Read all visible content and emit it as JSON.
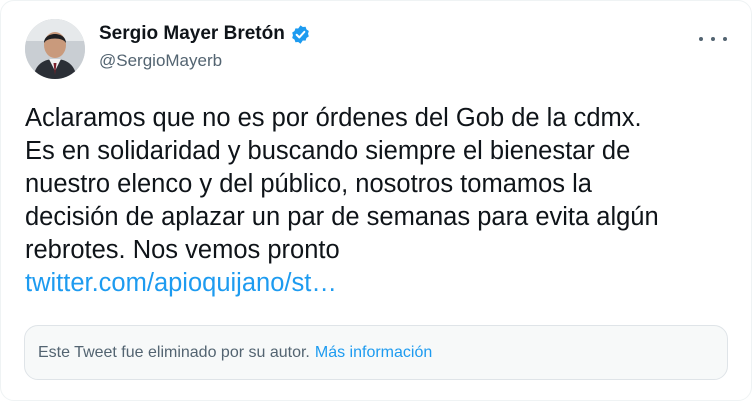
{
  "author": {
    "display_name": "Sergio Mayer Bretón",
    "handle": "@SergioMayerb"
  },
  "tweet": {
    "text": "Aclaramos que no es por órdenes del Gob de la cdmx.\nEs en solidaridad y buscando siempre el bienestar de\nnuestro elenco y del público, nosotros tomamos la\ndecisión de aplazar un par de semanas para evita algún\nrebrotes. Nos vemos pronto",
    "link": "twitter.com/apioquijano/st…"
  },
  "notice": {
    "text": "Este Tweet fue eliminado por su autor.",
    "link": "Más información"
  },
  "colors": {
    "accent": "#1d9bf0",
    "secondary_text": "#536471",
    "primary_text": "#0f1419"
  },
  "icons": {
    "verified": "verified-badge-icon",
    "more": "more-options-icon"
  }
}
